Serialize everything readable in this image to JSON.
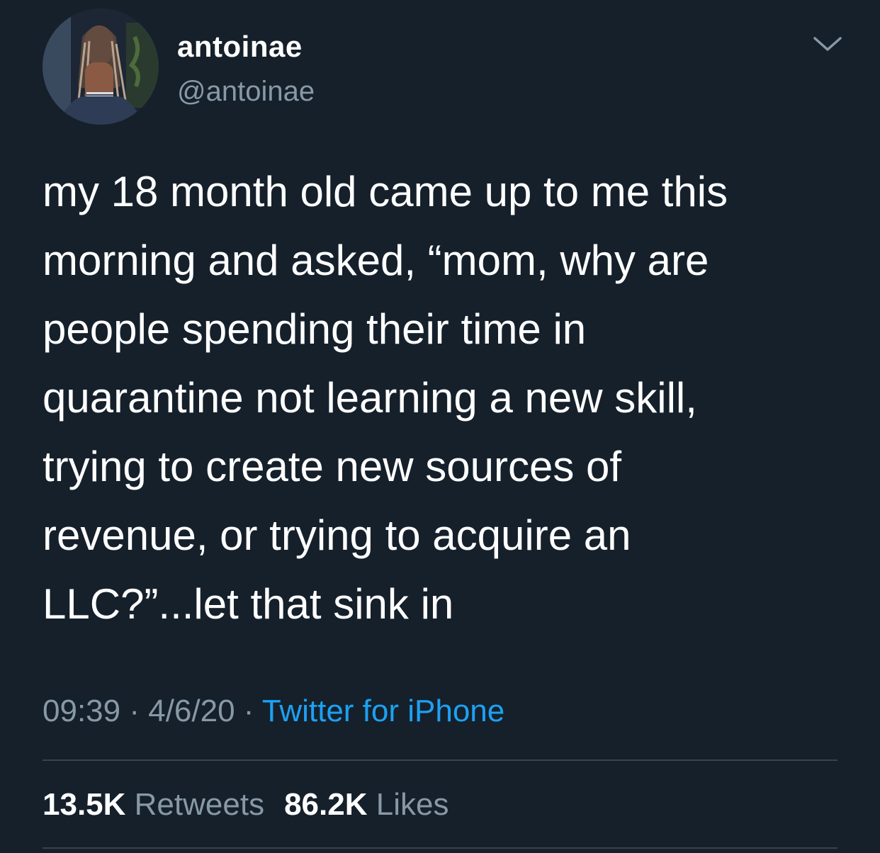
{
  "tweet": {
    "author": {
      "display_name": "antoinae",
      "handle": "@antoinae",
      "avatar_icon": "profile-photo"
    },
    "menu_icon": "chevron-down-icon",
    "text": "my 18 month old came up to me this\nmorning and asked, “mom, why are\npeople spending their time in\nquarantine not learning a new skill,\ntrying to create new sources of\nrevenue, or trying to acquire an\nLLC?”...let that sink in",
    "meta": {
      "time": "09:39",
      "separator": " · ",
      "date": "4/6/20",
      "source": "Twitter for iPhone"
    },
    "stats": {
      "retweets_count": "13.5K",
      "retweets_label": "Retweets",
      "likes_count": "86.2K",
      "likes_label": "Likes"
    }
  },
  "colors": {
    "background": "#15202b",
    "primary_text": "#ffffff",
    "secondary_text": "#8899a6",
    "link": "#1da1f2",
    "divider": "#38444d"
  }
}
